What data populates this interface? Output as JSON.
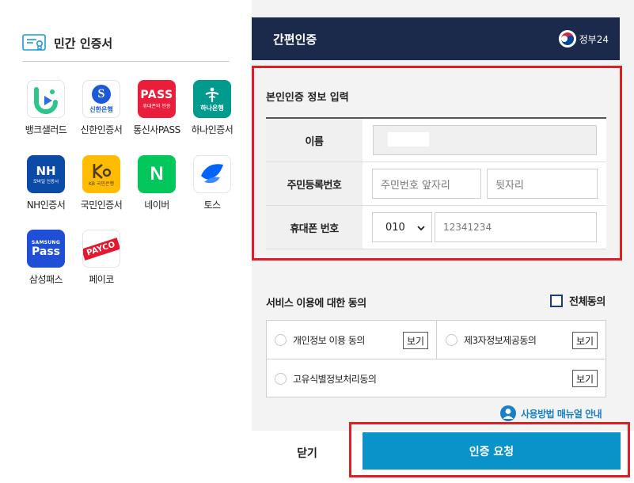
{
  "left": {
    "title": "민간 인증서",
    "providers": [
      {
        "name": "뱅크샐러드",
        "icon": "banksalad-logo-icon"
      },
      {
        "name": "신한인증서",
        "icon": "shinhan-logo-icon",
        "logo_text": "신한은행"
      },
      {
        "name": "통신사PASS",
        "icon": "pass-logo-icon",
        "logo_text": "PASS",
        "logo_subtext": "휴대폰와 인증"
      },
      {
        "name": "하나인증서",
        "icon": "hana-logo-icon",
        "logo_text": "하나은행"
      },
      {
        "name": "NH인증서",
        "icon": "nh-logo-icon",
        "logo_text": "NH",
        "logo_subtext": "모바일 인증서"
      },
      {
        "name": "국민인증서",
        "icon": "kb-logo-icon",
        "logo_text": "KB 국민은행"
      },
      {
        "name": "네이버",
        "icon": "naver-logo-icon",
        "logo_text": "N"
      },
      {
        "name": "토스",
        "icon": "toss-logo-icon"
      },
      {
        "name": "삼성패스",
        "icon": "samsung-pass-logo-icon",
        "logo_text": "Pass",
        "logo_subtext": "SAMSUNG"
      },
      {
        "name": "페이코",
        "icon": "payco-logo-icon",
        "logo_text": "PAYCO"
      }
    ]
  },
  "header": {
    "title": "간편인증",
    "gov_label": "정부24"
  },
  "form": {
    "title": "본인인증 정보 입력",
    "name_label": "이름",
    "name_value": "",
    "rrn_label": "주민등록번호",
    "rrn_front_placeholder": "주민번호 앞자리",
    "rrn_back_placeholder": "뒷자리",
    "phone_label": "휴대폰 번호",
    "phone_prefix": "010",
    "phone_placeholder": "12341234"
  },
  "agree": {
    "title": "서비스 이용에 대한 동의",
    "all_label": "전체동의",
    "items": [
      {
        "label": "개인정보 이용 동의",
        "view": "보기"
      },
      {
        "label": "제3자정보제공동의",
        "view": "보기"
      },
      {
        "label": "고유식별정보처리동의",
        "view": "보기"
      }
    ],
    "manual_label": "사용방법 매뉴얼 안내"
  },
  "buttons": {
    "close": "닫기",
    "request": "인증 요청"
  },
  "colors": {
    "header_bg": "#1b2a4a",
    "highlight_red": "#e01f25",
    "request_blue": "#0a93c9",
    "link_blue": "#1a7fc4"
  }
}
